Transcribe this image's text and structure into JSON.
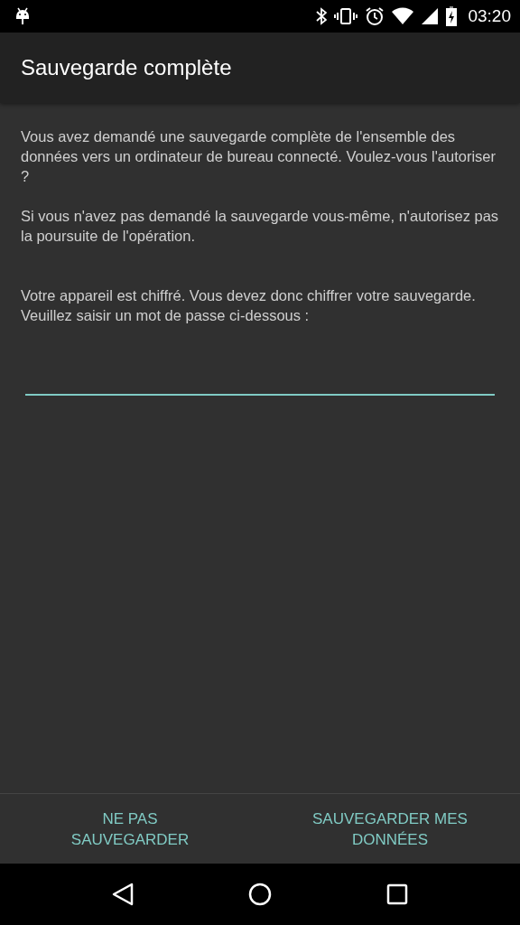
{
  "status_bar": {
    "time": "03:20"
  },
  "app_bar": {
    "title": "Sauvegarde complète"
  },
  "content": {
    "paragraphs": [
      "Vous avez demandé une sauvegarde complète de l'ensemble des données vers un ordinateur de bureau connecté. Voulez-vous l'autoriser ?",
      "Si vous n'avez pas demandé la sauvegarde vous-même, n'autorisez pas la poursuite de l'opération.",
      "Votre appareil est chiffré. Vous devez donc chiffrer votre sauvegarde. Veuillez saisir un mot de passe ci-dessous :"
    ],
    "password_field": {
      "focused": true
    }
  },
  "buttons": [
    "NE PAS SAUVEGARDER",
    "SAUVEGARDER MES DONNÉES"
  ]
}
